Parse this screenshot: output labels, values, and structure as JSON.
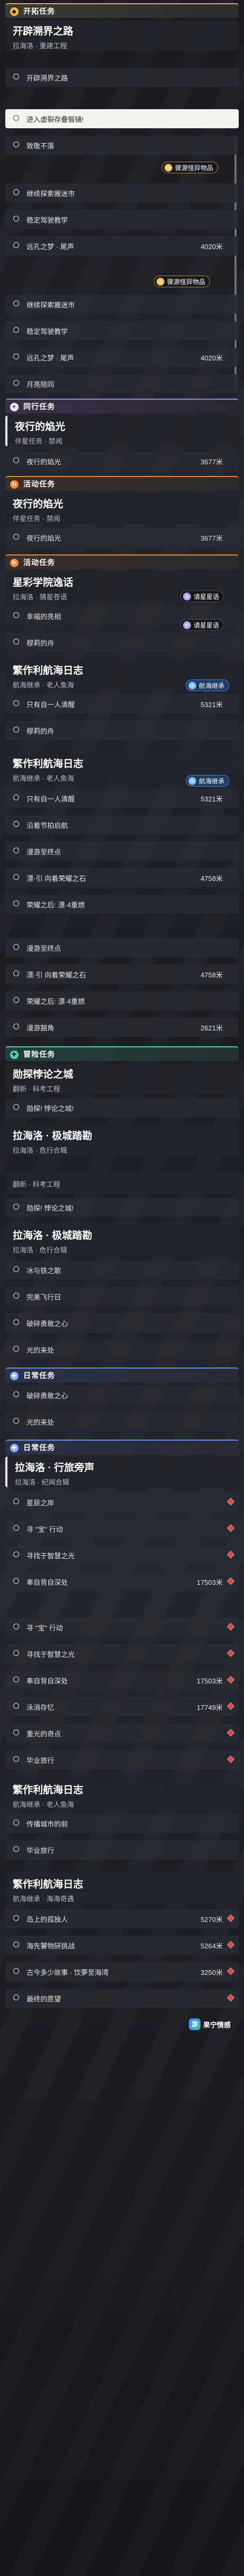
{
  "sections": {
    "trailblaze": "开拓任务",
    "companion": "同行任务",
    "adventure": "冒险任务",
    "event": "活动任务",
    "daily": "日常任务"
  },
  "quests": {
    "main": {
      "title": "开辟溯界之路",
      "subtitle": "拉海洛 · 重建工程"
    },
    "night": {
      "title": "夜行的焰光",
      "subtitle": "伴星任务 · 禁闻"
    },
    "academy": {
      "title": "星彩学院逸话",
      "subtitle": "拉海洛 · 猜星苍语"
    },
    "fragment": {
      "title": "繁作利航海日志",
      "subtitle": "航海继承 · 老人鱼海"
    },
    "tumult": {
      "title": "勋探悖论之城",
      "subtitle": "翻新 · 科考工程"
    },
    "hospital": {
      "title": "拉海洛 · 极城踏勘",
      "subtitle": "拉海洛 · 危行合辑"
    },
    "voyage": {
      "title": "拉海洛 · 行旅旁声",
      "subtitle": "拉海洛 · 纪闻合辑"
    },
    "log_sea": {
      "subtitle": "航海继承 · 海海奇遇"
    }
  },
  "steps": {
    "open_road": "开辟溯界之路",
    "enter_forge": "进入虚裂存叠锻铺!",
    "follow": "致敬不落",
    "continue_explore": "继续探索搬迷市",
    "control_wheel": "稳定驾驶教学",
    "long_dream": "远孔之梦 · 尾声",
    "dialog_yellow": "月亮陪同",
    "night_flame": "夜行的焰光",
    "lucky": "幸福的亮相",
    "my_flame": "穆莉的舟",
    "one_person": "只有自一人清醒",
    "sail_out": "沿着节拍启航",
    "starry_point": "漫游至终点",
    "journey4": "漂·引 向着荣耀之石",
    "journey_end": "荣耀之后: 漂·4重燃",
    "storm_gap": "漫游豁角",
    "tumult_fail": "勋探! 悖论之城!",
    "pair": "冰与铁之歌",
    "fly": "完美飞行日",
    "brain": "破碎勇敢之心",
    "heart": "光的来处",
    "gathering": "星辰之岸",
    "treasure": "寻 \"宝\" 行动",
    "stay": "寻找于智慧之光",
    "home": "奉自背自深处",
    "wave": "泳消存忆",
    "wonder": "重光的奇点",
    "lesson": "毕业旅行",
    "alone": "传播城市的前",
    "stranger": "岛上的孤独人",
    "road_fish": "海先饕物研挑战",
    "ancient": "古今多少故事 · 饮夢至海湾",
    "dream": "最终的愿望"
  },
  "values": {
    "d4020": "4020米",
    "d3677": "3677米",
    "d5321": "5321米",
    "d4758": "4758米",
    "d2621": "2621米",
    "d17503": "17503米",
    "d17749": "17749米",
    "d5270": "5270米",
    "d5264": "5264米",
    "d3250": "3250米"
  },
  "badges": {
    "tracking": "骤源怪异物品",
    "pending": "请星星语",
    "sea_link": "航海继承",
    "new_route": "道舶观望"
  },
  "brand": {
    "logo": "游",
    "label": "果宁情感"
  }
}
